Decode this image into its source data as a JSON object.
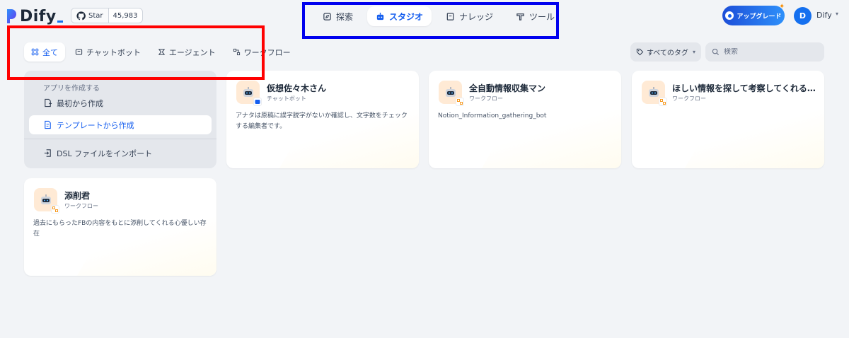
{
  "app": {
    "logo_text": "Dify",
    "brand_color": "#155eef"
  },
  "github": {
    "star_label": "Star",
    "star_count": "45,983",
    "icon": "github-icon"
  },
  "nav": {
    "items": [
      {
        "label": "探索",
        "icon": "compass-icon",
        "active": false
      },
      {
        "label": "スタジオ",
        "icon": "robot-icon",
        "active": true
      },
      {
        "label": "ナレッジ",
        "icon": "book-icon",
        "active": false
      },
      {
        "label": "ツール",
        "icon": "hammer-icon",
        "active": false
      }
    ]
  },
  "header": {
    "upgrade_label": "アップグレード",
    "user_initial": "D",
    "user_name": "Dify"
  },
  "filters": {
    "tabs": [
      {
        "label": "全て",
        "icon": "grid-icon",
        "active": true
      },
      {
        "label": "チャットボット",
        "icon": "chat-icon",
        "active": false
      },
      {
        "label": "エージェント",
        "icon": "agent-icon",
        "active": false
      },
      {
        "label": "ワークフロー",
        "icon": "workflow-icon",
        "active": false
      }
    ],
    "tag_filter_label": "すべてのタグ",
    "search_placeholder": "検索"
  },
  "create_panel": {
    "title": "アプリを作成する",
    "from_scratch": "最初から作成",
    "from_template": "テンプレートから作成",
    "import_dsl": "DSL ファイルをインポート"
  },
  "apps": [
    {
      "name": "仮想佐々木さん",
      "type": "チャットボット",
      "badge": "chatbot-icon",
      "description": "アナタは原稿に誤字脱字がないか確認し、文字数をチェックする編集者です。"
    },
    {
      "name": "全自動情報収集マン",
      "type": "ワークフロー",
      "badge": "workflow-icon",
      "description": "Notion_Information_gathering_bot"
    },
    {
      "name": "ほしい情報を探して考察してくれる優しい...",
      "type": "ワークフロー",
      "badge": "workflow-icon",
      "description": ""
    },
    {
      "name": "添削君",
      "type": "ワークフロー",
      "badge": "workflow-icon",
      "description": "過去にもらったFBの内容をもとに添削してくれる心優しい存在"
    }
  ],
  "annotations": {
    "red_color": "#ff0000",
    "blue_color": "#0000ee"
  }
}
